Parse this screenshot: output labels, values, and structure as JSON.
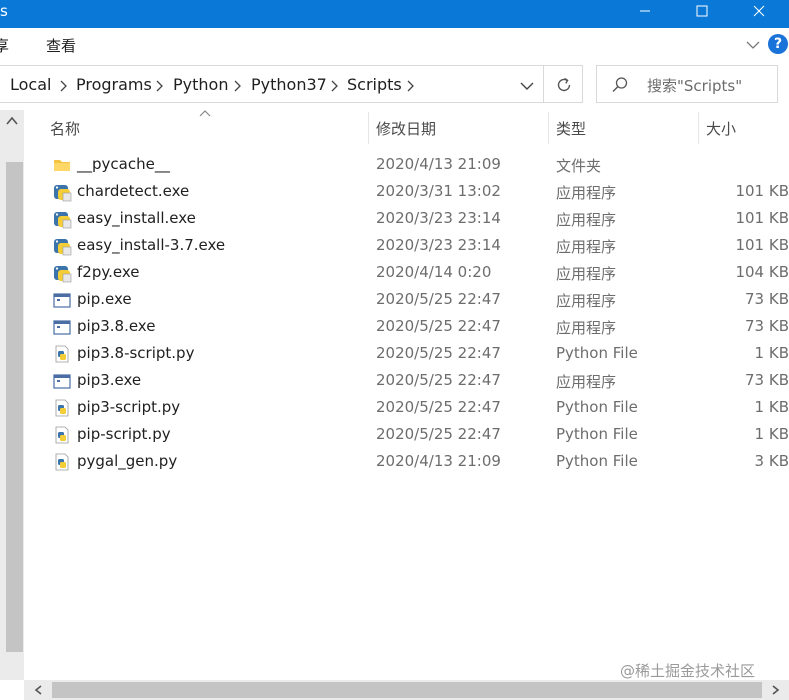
{
  "window": {
    "title_fragment": "s",
    "controls": {
      "minimize": "minimize",
      "maximize": "maximize",
      "close": "close"
    }
  },
  "ribbon": {
    "tabs": [
      {
        "label": "享"
      },
      {
        "label": "查看"
      }
    ],
    "help_label": "?"
  },
  "address_bar": {
    "breadcrumbs": [
      "Local",
      "Programs",
      "Python",
      "Python37",
      "Scripts"
    ]
  },
  "search": {
    "placeholder": "搜索\"Scripts\""
  },
  "columns": {
    "name": "名称",
    "date": "修改日期",
    "type": "类型",
    "size": "大小"
  },
  "files": [
    {
      "name": "__pycache__",
      "date": "2020/4/13 21:09",
      "type": "文件夹",
      "size": "",
      "icon": "folder-icon"
    },
    {
      "name": "chardetect.exe",
      "date": "2020/3/31 13:02",
      "type": "应用程序",
      "size": "101 KB",
      "icon": "python-exe-icon"
    },
    {
      "name": "easy_install.exe",
      "date": "2020/3/23 23:14",
      "type": "应用程序",
      "size": "101 KB",
      "icon": "python-exe-icon"
    },
    {
      "name": "easy_install-3.7.exe",
      "date": "2020/3/23 23:14",
      "type": "应用程序",
      "size": "101 KB",
      "icon": "python-exe-icon"
    },
    {
      "name": "f2py.exe",
      "date": "2020/4/14 0:20",
      "type": "应用程序",
      "size": "104 KB",
      "icon": "python-exe-icon"
    },
    {
      "name": "pip.exe",
      "date": "2020/5/25 22:47",
      "type": "应用程序",
      "size": "73 KB",
      "icon": "window-exe-icon"
    },
    {
      "name": "pip3.8.exe",
      "date": "2020/5/25 22:47",
      "type": "应用程序",
      "size": "73 KB",
      "icon": "window-exe-icon"
    },
    {
      "name": "pip3.8-script.py",
      "date": "2020/5/25 22:47",
      "type": "Python File",
      "size": "1 KB",
      "icon": "python-file-icon"
    },
    {
      "name": "pip3.exe",
      "date": "2020/5/25 22:47",
      "type": "应用程序",
      "size": "73 KB",
      "icon": "window-exe-icon"
    },
    {
      "name": "pip3-script.py",
      "date": "2020/5/25 22:47",
      "type": "Python File",
      "size": "1 KB",
      "icon": "python-file-icon"
    },
    {
      "name": "pip-script.py",
      "date": "2020/5/25 22:47",
      "type": "Python File",
      "size": "1 KB",
      "icon": "python-file-icon"
    },
    {
      "name": "pygal_gen.py",
      "date": "2020/4/13 21:09",
      "type": "Python File",
      "size": "3 KB",
      "icon": "python-file-icon"
    }
  ],
  "watermark": "@稀土掘金技术社区",
  "colors": {
    "titlebar": "#0a78d7",
    "help_button": "#1a73d9",
    "folder": "#f5c342"
  }
}
